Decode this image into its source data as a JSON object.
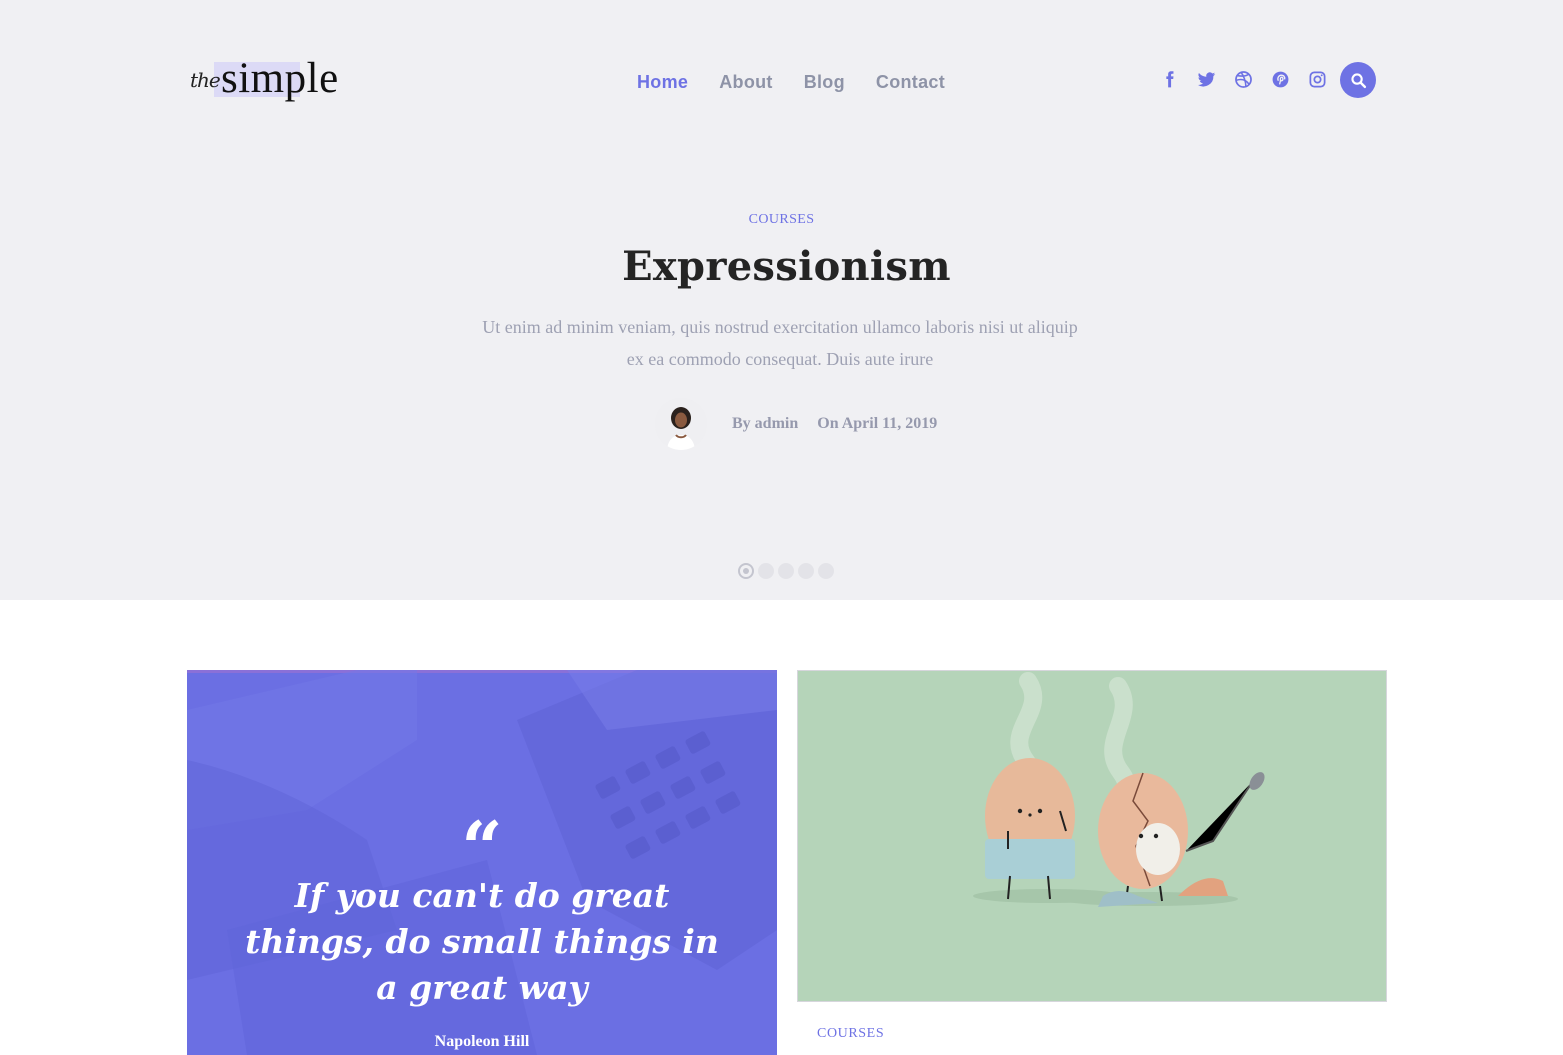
{
  "brand": {
    "prefix": "the",
    "word": "simple"
  },
  "nav": {
    "items": [
      {
        "label": "Home",
        "active": true
      },
      {
        "label": "About",
        "active": false
      },
      {
        "label": "Blog",
        "active": false
      },
      {
        "label": "Contact",
        "active": false
      }
    ]
  },
  "social": {
    "icons": [
      "facebook-icon",
      "twitter-icon",
      "dribbble-icon",
      "pinterest-icon",
      "instagram-icon"
    ],
    "search_icon": "search-icon"
  },
  "hero": {
    "category": "COURSES",
    "title": "Expressionism",
    "excerpt_line1": "Ut enim ad minim veniam, quis nostrud exercitation ullamco laboris nisi ut aliquip",
    "excerpt_line2": "ex ea commodo consequat. Duis aute irure",
    "author": "By admin",
    "date": "On April 11, 2019",
    "slide_count": 5,
    "active_slide": 1
  },
  "quote_card": {
    "glyph": "“",
    "text": "If you can't do great things, do small things in a great way",
    "author": "Napoleon Hill"
  },
  "post_card": {
    "category": "COURSES"
  },
  "colors": {
    "accent": "#6e72e4",
    "hero_bg": "#f0f0f3",
    "nav_text": "#8e93a7",
    "title": "#242424",
    "excerpt": "#9ea1b3",
    "quote_bg": "#6b6fe3",
    "post_img_bg": "#b5d4b9"
  }
}
